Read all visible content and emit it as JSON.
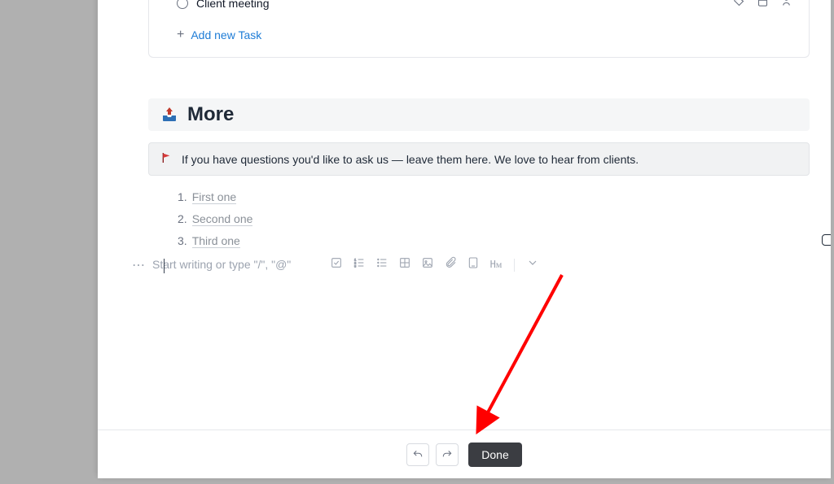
{
  "task_card": {
    "task_title": "Client meeting",
    "add_new_task": "Add new Task"
  },
  "more": {
    "title": "More",
    "info_text": "If you have questions you'd like to ask us — leave them here. We love to hear from clients.",
    "list": [
      {
        "num": "1.",
        "text": "First one"
      },
      {
        "num": "2.",
        "text": "Second one"
      },
      {
        "num": "3.",
        "text": "Third one"
      }
    ]
  },
  "editor": {
    "placeholder": "Start writing or type \"/\", \"@\"",
    "heading_tool": "Hᴍ"
  },
  "footer": {
    "done_label": "Done"
  }
}
